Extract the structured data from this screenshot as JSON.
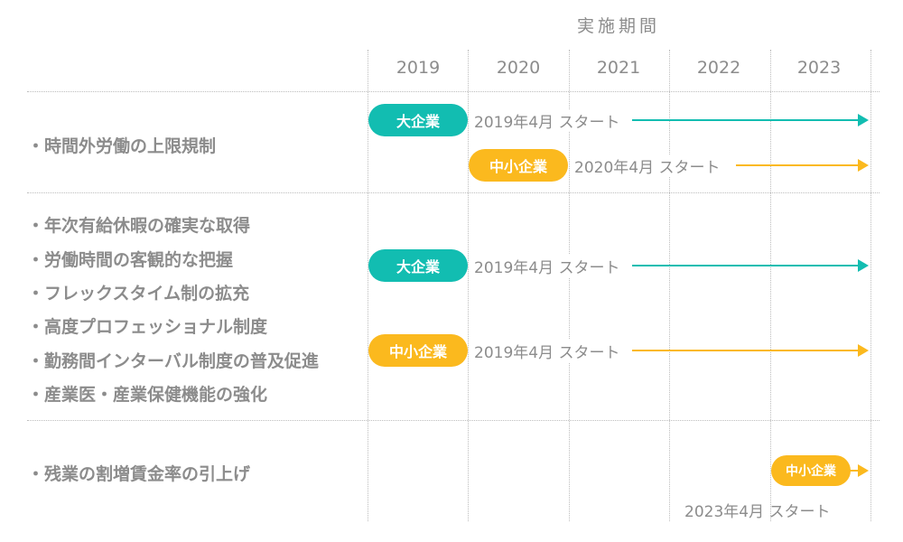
{
  "header": {
    "period_title": "実施期間",
    "years": [
      "2019",
      "2020",
      "2021",
      "2022",
      "2023"
    ]
  },
  "colors": {
    "large_enterprise": "#12bdb1",
    "sme": "#fbb91e",
    "text": "#8c8c8c"
  },
  "sections": [
    {
      "items": [
        "時間外労働の上限規制"
      ],
      "timelines": [
        {
          "badge": "大企業",
          "start_label": "2019年4月 スタート",
          "start_year": 2019,
          "type": "large"
        },
        {
          "badge": "中小企業",
          "start_label": "2020年4月 スタート",
          "start_year": 2020,
          "type": "sme"
        }
      ]
    },
    {
      "items": [
        "年次有給休暇の確実な取得",
        "労働時間の客観的な把握",
        "フレックスタイム制の拡充",
        "高度プロフェッショナル制度",
        "勤務間インターバル制度の普及促進",
        "産業医・産業保健機能の強化"
      ],
      "timelines": [
        {
          "badge": "大企業",
          "start_label": "2019年4月 スタート",
          "start_year": 2019,
          "type": "large"
        },
        {
          "badge": "中小企業",
          "start_label": "2019年4月 スタート",
          "start_year": 2019,
          "type": "sme"
        }
      ]
    },
    {
      "items": [
        "残業の割増賃金率の引上げ"
      ],
      "timelines": [
        {
          "badge": "中小企業",
          "start_label": "2023年4月 スタート",
          "start_year": 2023,
          "type": "sme"
        }
      ]
    }
  ]
}
